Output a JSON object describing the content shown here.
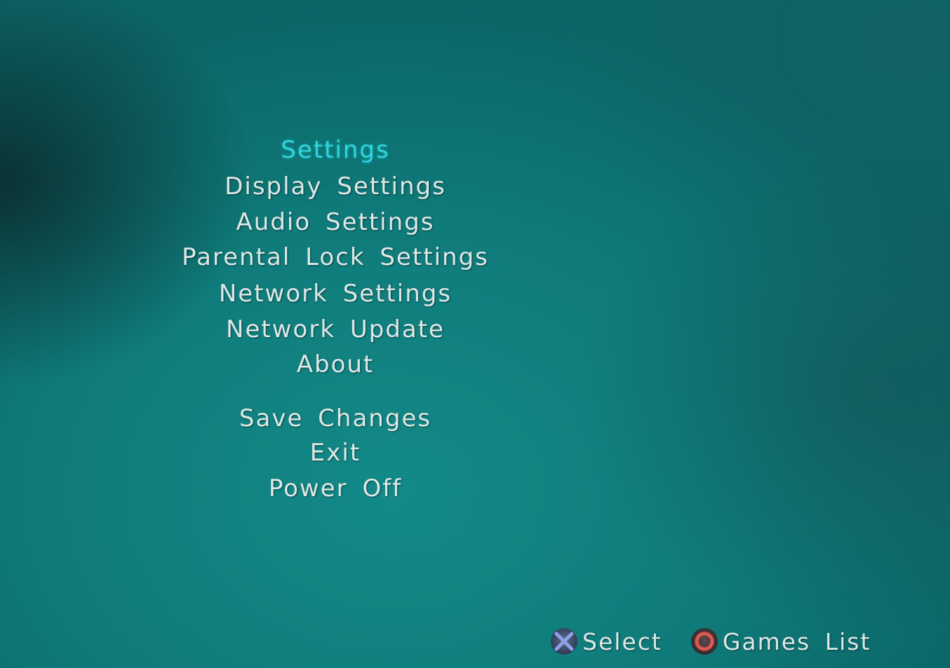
{
  "menu": {
    "title": "Settings",
    "items": [
      "Display Settings",
      "Audio Settings",
      "Parental Lock Settings",
      "Network Settings",
      "Network Update",
      "About"
    ],
    "actions": [
      "Save Changes",
      "Exit",
      "Power Off"
    ]
  },
  "footer": {
    "hints": [
      {
        "icon": "cross-button-icon",
        "label": "Select"
      },
      {
        "icon": "circle-button-icon",
        "label": "Games List"
      }
    ]
  },
  "colors": {
    "title": "#2fd4dc",
    "text": "#dde8e6",
    "background": "#0f7b7a",
    "cross_button": "#7d8fd6",
    "circle_button": "#e0584f"
  }
}
